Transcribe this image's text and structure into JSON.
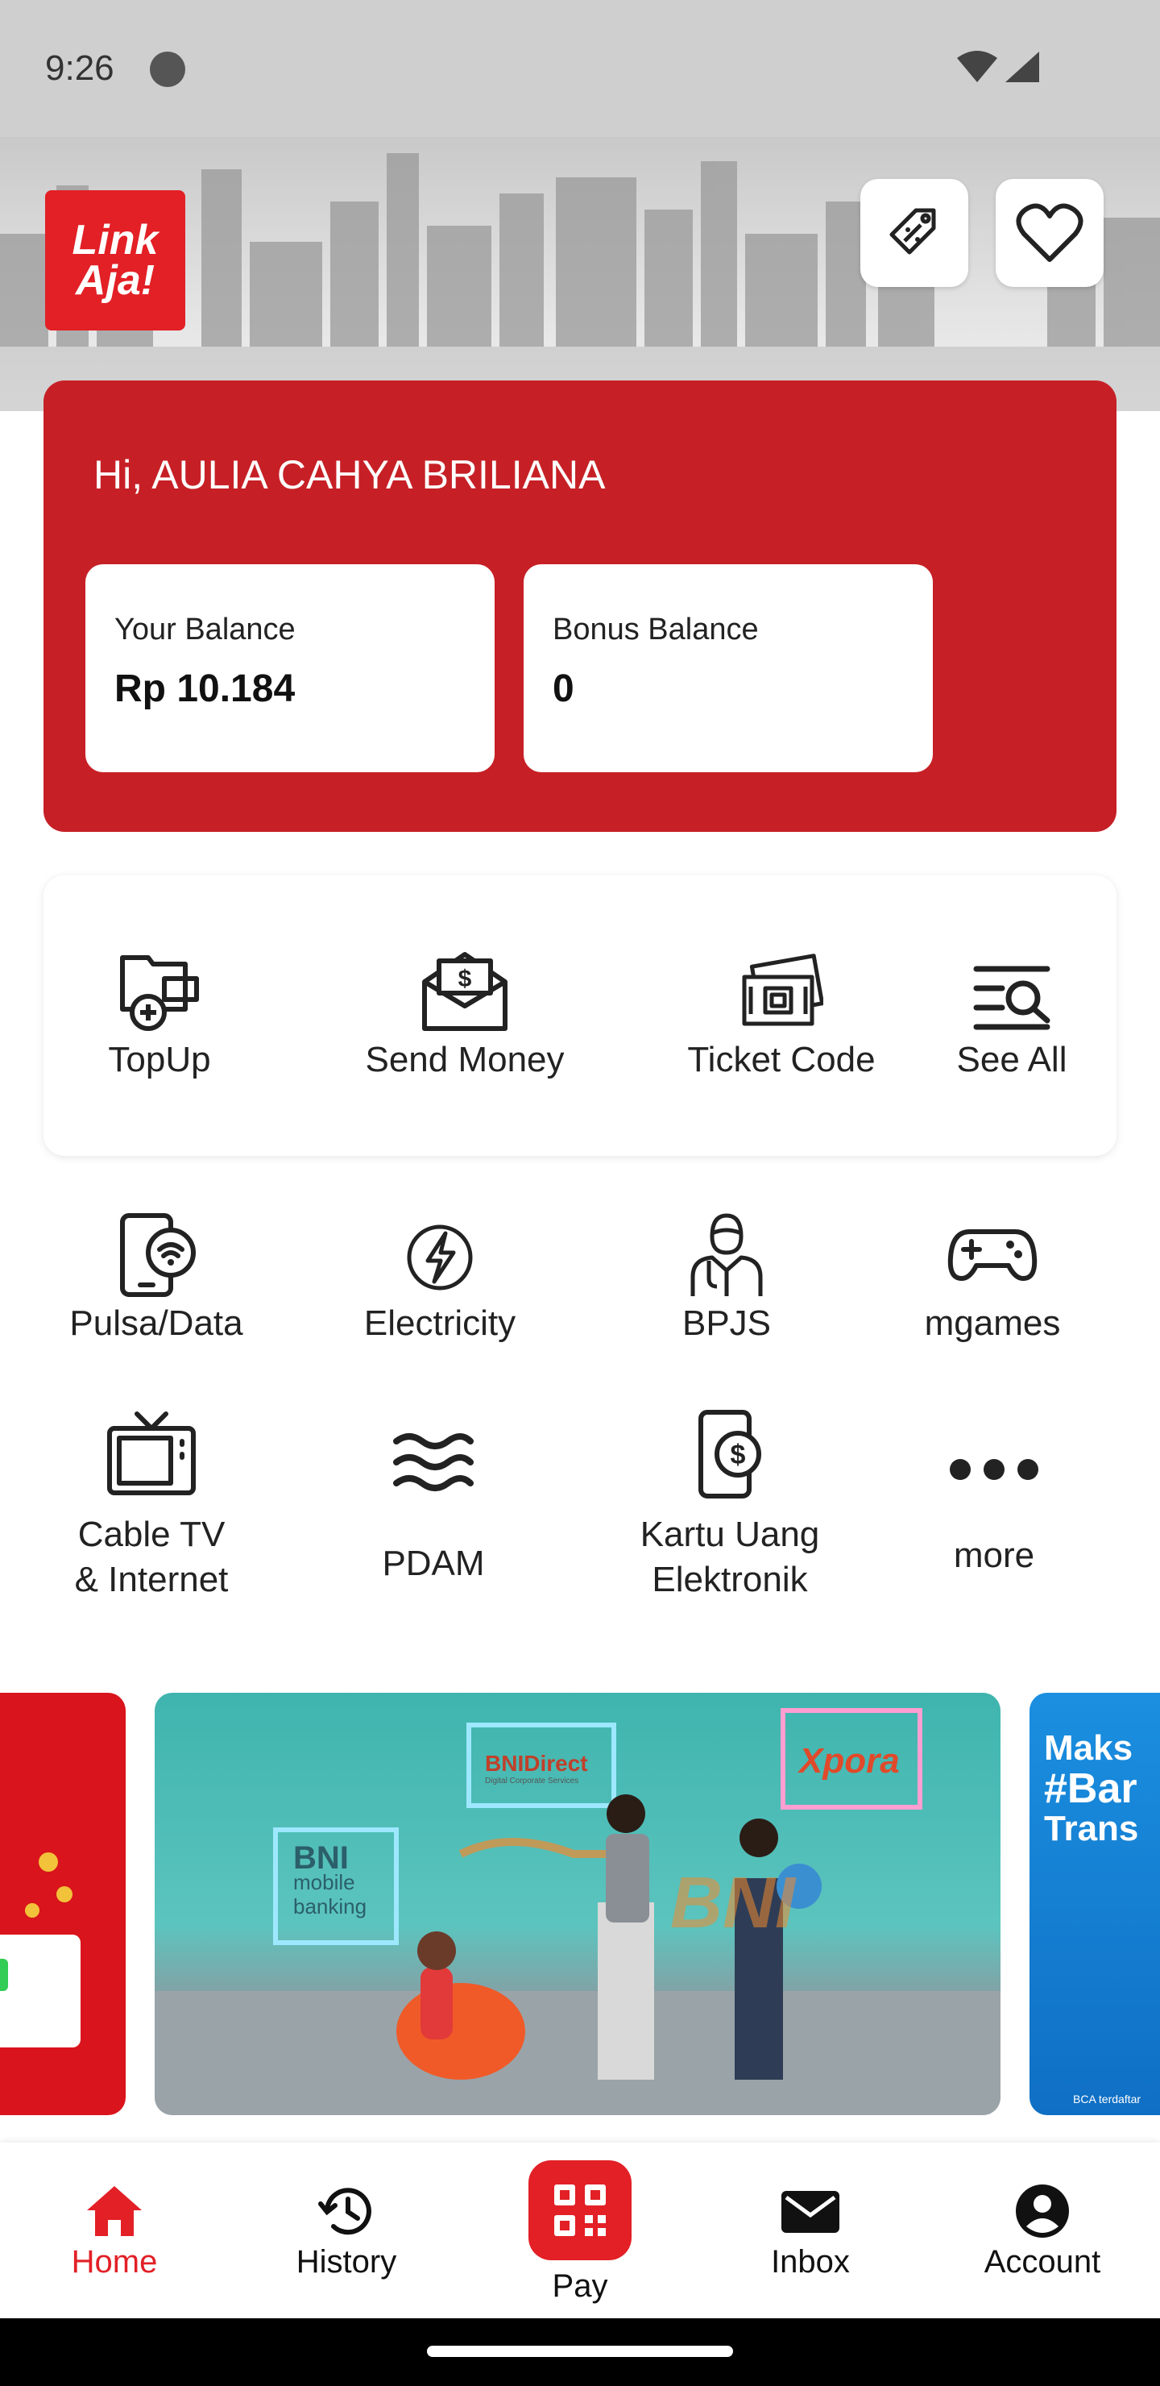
{
  "status_bar": {
    "time": "9:26"
  },
  "header": {
    "logo_lines": [
      "Link",
      "Aja!"
    ],
    "icons": [
      "discount-tag-icon",
      "heart-icon"
    ]
  },
  "greeting": {
    "text": "Hi, AULIA CAHYA BRILIANA",
    "balance_label": "Your Balance",
    "balance_value": "Rp 10.184",
    "bonus_label": "Bonus Balance",
    "bonus_value": "0"
  },
  "quick_menu": [
    {
      "label": "TopUp",
      "icon": "wallet-plus-icon"
    },
    {
      "label": "Send Money",
      "icon": "money-envelope-icon"
    },
    {
      "label": "Ticket Code",
      "icon": "ticket-code-icon"
    },
    {
      "label": "See All",
      "icon": "list-search-icon"
    }
  ],
  "services": [
    {
      "label": "Pulsa/Data",
      "icon": "phone-wifi-icon"
    },
    {
      "label": "Electricity",
      "icon": "lightning-icon"
    },
    {
      "label": "BPJS",
      "icon": "doctor-icon"
    },
    {
      "label": "mgames",
      "icon": "gamepad-icon"
    },
    {
      "label_lines": [
        "Cable TV",
        "& Internet"
      ],
      "icon": "tv-icon"
    },
    {
      "label": "PDAM",
      "icon": "water-waves-icon"
    },
    {
      "label_lines": [
        "Kartu Uang",
        "Elektronik"
      ],
      "icon": "card-money-icon"
    },
    {
      "label": "more",
      "icon": "more-dots-icon"
    }
  ],
  "banners": {
    "main": {
      "brand_direct": "BNIDirect",
      "brand_direct_sub": "Digital Corporate Services",
      "brand_xpora": "Xpora",
      "brand_mobile_lines": [
        "BNI",
        "mobile",
        "banking"
      ],
      "anniversary": "BNI"
    },
    "right_text_lines": [
      "Maks",
      "#Bar",
      "Trans"
    ],
    "right_footer": "BCA terdaftar"
  },
  "bottom_nav": [
    {
      "label": "Home",
      "icon": "home-icon",
      "active": true
    },
    {
      "label": "History",
      "icon": "history-icon",
      "active": false
    },
    {
      "label": "Pay",
      "icon": "qr-code-icon",
      "active": false
    },
    {
      "label": "Inbox",
      "icon": "mail-icon",
      "active": false
    },
    {
      "label": "Account",
      "icon": "account-icon",
      "active": false
    }
  ],
  "colors": {
    "brand_red": "#e22026",
    "card_red": "#c62026",
    "banner_teal": "#3fb4ae"
  }
}
